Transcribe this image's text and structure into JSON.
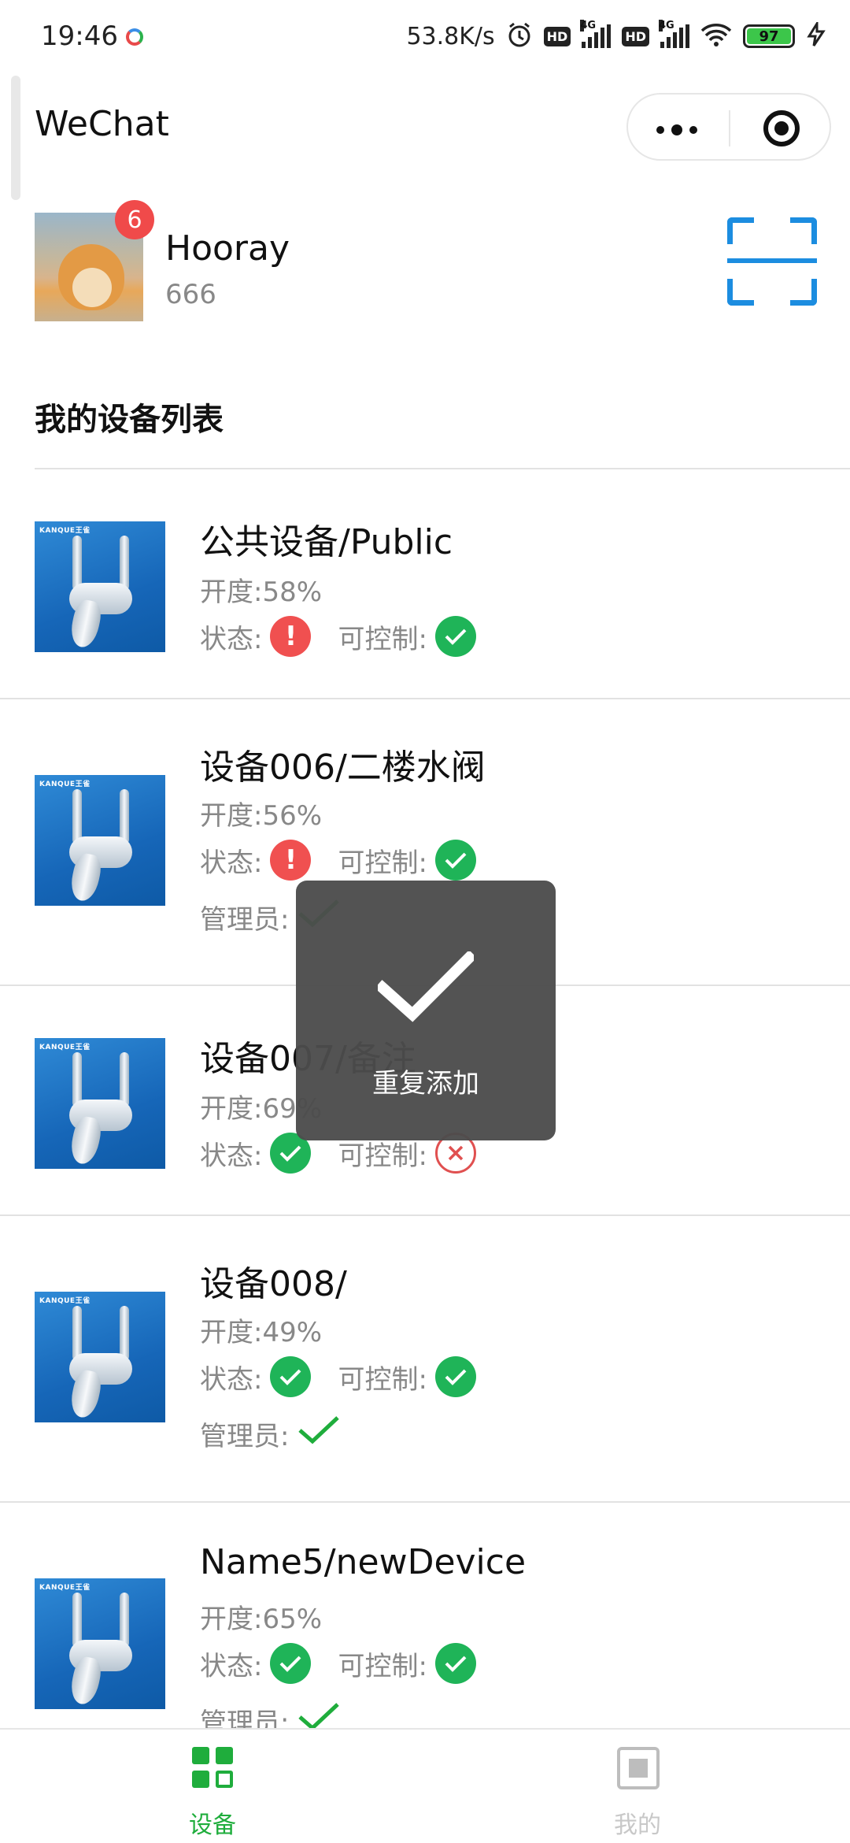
{
  "status_bar": {
    "time": "19:46",
    "speed": "53.8K/s",
    "hd1": "HD",
    "net1": "4G",
    "hd2": "HD",
    "net2": "4G",
    "battery": "97",
    "icons": [
      "alarm-icon",
      "signal-icon",
      "wifi-icon",
      "battery-icon",
      "charging-icon"
    ]
  },
  "navbar": {
    "title": "WeChat",
    "menu_icon": "more-dots-icon",
    "close_icon": "target-icon"
  },
  "profile": {
    "name": "Hooray",
    "subtitle": "666",
    "badge": "6",
    "scan_icon": "scan-icon"
  },
  "section_title": "我的设备列表",
  "labels": {
    "opening_prefix": "开度:",
    "status": "状态:",
    "controllable": "可控制:",
    "admin": "管理员:"
  },
  "devices": [
    {
      "title": "公共设备/Public",
      "opening": "开度:58%",
      "status": "error",
      "controllable": "yes",
      "admin": null
    },
    {
      "title": "设备006/二楼水阀",
      "opening": "开度:56%",
      "status": "error",
      "controllable": "yes",
      "admin": "yes"
    },
    {
      "title": "设备007/备注",
      "opening": "开度:69%",
      "status": "ok",
      "controllable": "no",
      "admin": null
    },
    {
      "title": "设备008/",
      "opening": "开度:49%",
      "status": "ok",
      "controllable": "yes",
      "admin": "yes"
    },
    {
      "title": "Name5/newDevice",
      "opening": "开度:65%",
      "status": "ok",
      "controllable": "yes",
      "admin": "yes"
    }
  ],
  "toast": {
    "message": "重复添加",
    "icon": "checkmark-icon"
  },
  "tabbar": {
    "tabs": [
      {
        "label": "设备",
        "icon": "grid-icon",
        "active": true
      },
      {
        "label": "我的",
        "icon": "chip-icon",
        "active": false
      }
    ]
  },
  "colors": {
    "accent_green": "#1fad3c",
    "ok_green": "#1fb458",
    "error_red": "#f05050",
    "scan_blue": "#1c8de0",
    "toast_bg": "#4c4c4c"
  },
  "thumb_brand": "KANQUE王雀"
}
